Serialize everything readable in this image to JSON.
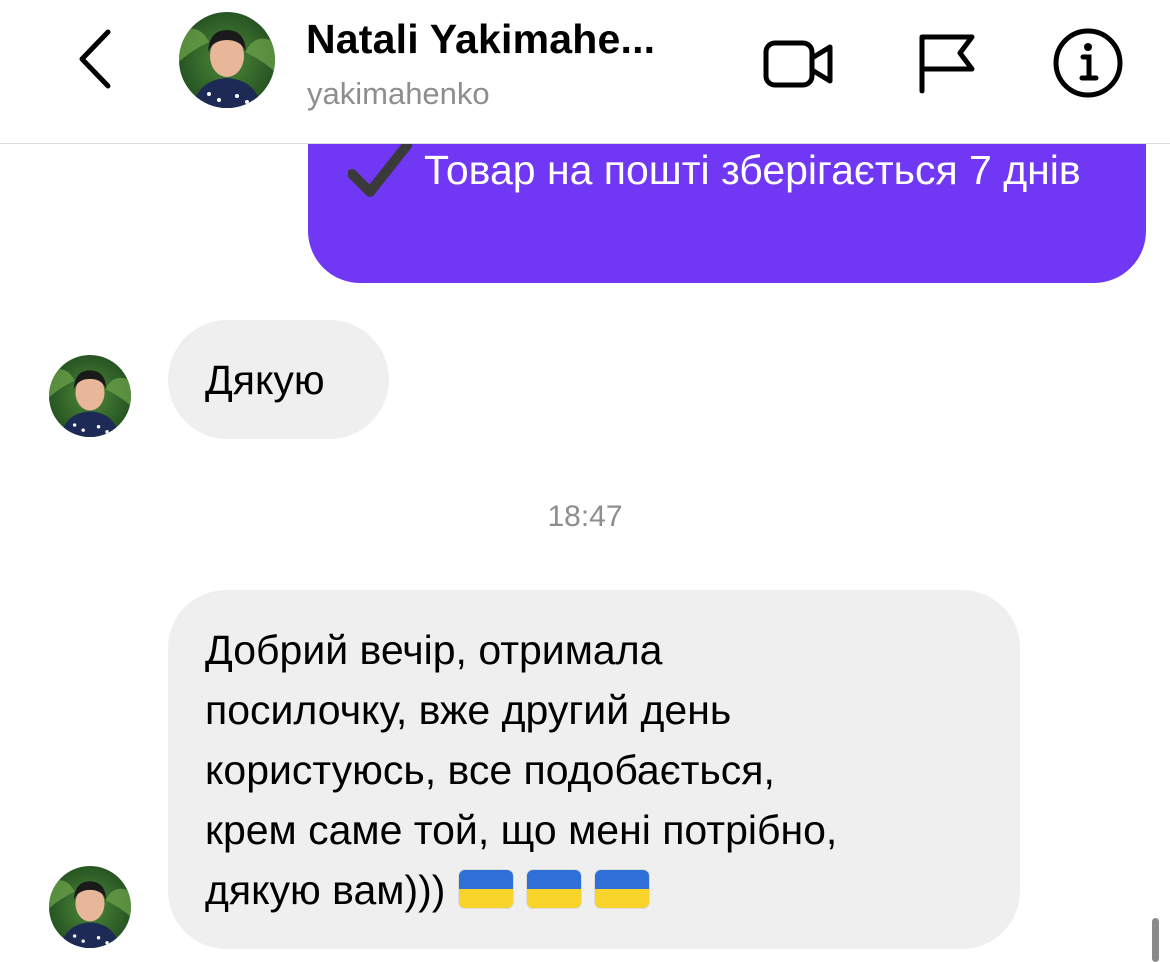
{
  "header": {
    "contact_name": "Natali Yakimahe...",
    "contact_handle": "yakimahenko",
    "icons": {
      "back": "chevron-left-icon",
      "video": "video-call-icon",
      "flag": "flag-icon",
      "info": "info-icon"
    }
  },
  "messages": {
    "outgoing_1": {
      "text": "Товар на пошті зберігається 7 днів",
      "icon": "checkmark-icon",
      "bubble_color": "#7037f5"
    },
    "incoming_1": {
      "text": "Дякую"
    },
    "timestamp": "18:47",
    "incoming_2": {
      "line1": "Добрий вечір, отримала",
      "line2": "посилочку, вже другий день",
      "line3": "користуюсь, все подобається,",
      "line4": "крем саме той, що мені потрібно,",
      "line5": "дякую вам)))",
      "emoji": [
        "ukraine-flag",
        "ukraine-flag",
        "ukraine-flag"
      ]
    }
  },
  "colors": {
    "accent": "#7037f5",
    "incoming_bubble": "#efefef",
    "secondary_text": "#8e8e8e"
  }
}
